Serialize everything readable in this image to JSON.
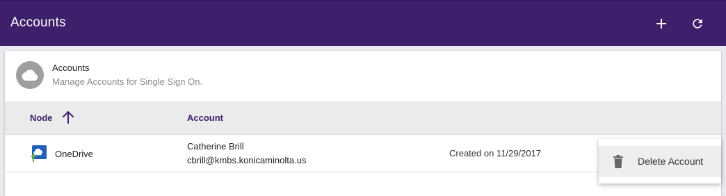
{
  "appbar": {
    "title": "Accounts",
    "add_icon": "plus-icon",
    "refresh_icon": "refresh-icon",
    "color": "#3d1f6b"
  },
  "card": {
    "avatar_icon": "cloud-icon",
    "title": "Accounts",
    "subtitle": "Manage Accounts for Single Sign On."
  },
  "table": {
    "columns": [
      "Node",
      "Account"
    ],
    "sort": {
      "column": "Node",
      "direction": "ascending",
      "icon": "arrow-up-icon"
    },
    "rows": [
      {
        "node_icon": "onedrive-icon",
        "node": "OneDrive",
        "account_name": "Catherine Brill",
        "account_email": "cbrill@kmbs.konicaminolta.us",
        "created": "Created on 11/29/2017"
      }
    ]
  },
  "context_menu": {
    "items": [
      {
        "label": "Delete Account",
        "icon": "trash-icon"
      }
    ]
  }
}
